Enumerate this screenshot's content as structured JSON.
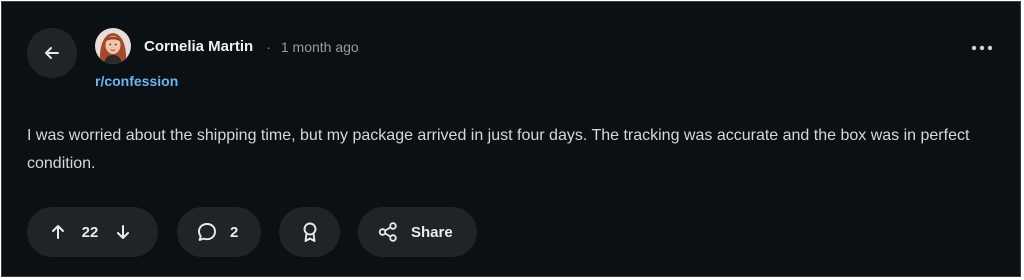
{
  "post": {
    "author": "Cornelia Martin",
    "separator": "·",
    "time_ago": "1 month ago",
    "subreddit": "r/confession",
    "body": "I was worried about the shipping time, but my package arrived in just four days. The tracking was accurate and the box was in perfect condition."
  },
  "actions": {
    "vote_count": "22",
    "comment_count": "2",
    "share_label": "Share"
  },
  "icons": {
    "back": "arrow-left-icon",
    "more": "more-horizontal-icon",
    "upvote": "arrow-up-icon",
    "downvote": "arrow-down-icon",
    "comment": "comment-bubble-icon",
    "award": "award-ribbon-icon",
    "share": "share-nodes-icon"
  },
  "colors": {
    "background": "#0b1015",
    "pill": "#202428",
    "link": "#6fb4f0",
    "text": "#e6e9ec"
  }
}
